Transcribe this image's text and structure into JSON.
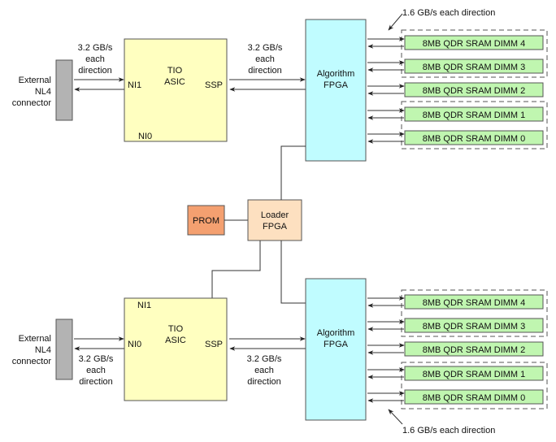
{
  "colors": {
    "connector": "#b3b3b3",
    "tio_asic": "#ffffc0",
    "algorithm_fpga": "#c0fcff",
    "dimm": "#c0f6b0",
    "prom": "#f4a070",
    "loader_fpga": "#fde0c0"
  },
  "top": {
    "connector_label": [
      "External",
      "NL4",
      "connector"
    ],
    "link_left_label": [
      "3.2 GB/s",
      "each",
      "direction"
    ],
    "tio_label": [
      "TIO",
      "ASIC"
    ],
    "port_ni_side": "NI1",
    "port_ni_other": "NI0",
    "port_ssp": "SSP",
    "link_right_label": [
      "3.2 GB/s",
      "each",
      "direction"
    ],
    "fpga_label": [
      "Algorithm",
      "FPGA"
    ],
    "dimm_bandwidth_note": "1.6 GB/s each direction",
    "dimms": [
      "8MB QDR SRAM DIMM 4",
      "8MB QDR SRAM DIMM 3",
      "8MB QDR SRAM DIMM 2",
      "8MB QDR SRAM DIMM 1",
      "8MB QDR SRAM DIMM 0"
    ]
  },
  "middle": {
    "prom_label": "PROM",
    "loader_label": [
      "Loader",
      "FPGA"
    ]
  },
  "bottom": {
    "connector_label": [
      "External",
      "NL4",
      "connector"
    ],
    "link_left_label": [
      "3.2 GB/s",
      "each",
      "direction"
    ],
    "tio_label": [
      "TIO",
      "ASIC"
    ],
    "port_ni_side": "NI0",
    "port_ni_other": "NI1",
    "port_ssp": "SSP",
    "link_right_label": [
      "3.2 GB/s",
      "each",
      "direction"
    ],
    "fpga_label": [
      "Algorithm",
      "FPGA"
    ],
    "dimm_bandwidth_note": "1.6 GB/s each direction",
    "dimms": [
      "8MB QDR SRAM DIMM 4",
      "8MB QDR SRAM DIMM 3",
      "8MB QDR SRAM DIMM 2",
      "8MB QDR SRAM DIMM 1",
      "8MB QDR SRAM DIMM 0"
    ]
  }
}
